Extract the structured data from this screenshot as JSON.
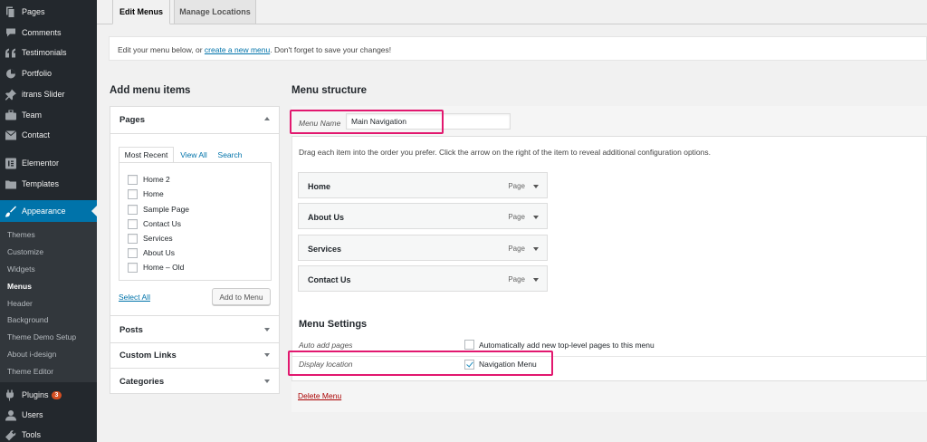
{
  "sidebar": {
    "items": [
      {
        "label": "Pages",
        "icon": "pages-icon"
      },
      {
        "label": "Comments",
        "icon": "comments-icon"
      },
      {
        "label": "Testimonials",
        "icon": "quote-icon"
      },
      {
        "label": "Portfolio",
        "icon": "portfolio-icon"
      },
      {
        "label": "itrans Slider",
        "icon": "pin-icon"
      },
      {
        "label": "Team",
        "icon": "team-icon"
      },
      {
        "label": "Contact",
        "icon": "mail-icon"
      },
      {
        "label": "Elementor",
        "icon": "elementor-icon"
      },
      {
        "label": "Templates",
        "icon": "folder-icon"
      },
      {
        "label": "Appearance",
        "icon": "brush-icon"
      },
      {
        "label": "Plugins",
        "icon": "plug-icon",
        "badge": "3"
      },
      {
        "label": "Users",
        "icon": "user-icon"
      },
      {
        "label": "Tools",
        "icon": "wrench-icon"
      }
    ],
    "submenu": [
      "Themes",
      "Customize",
      "Widgets",
      "Menus",
      "Header",
      "Background",
      "Theme Demo Setup",
      "About i-design",
      "Theme Editor"
    ],
    "current_submenu": "Menus"
  },
  "tabs": {
    "edit_menus": "Edit Menus",
    "manage_locations": "Manage Locations"
  },
  "notice": {
    "before": "Edit your menu below, or ",
    "link": "create a new menu",
    "after": ". Don't forget to save your changes!"
  },
  "add_items": {
    "title": "Add menu items",
    "pages": {
      "header": "Pages",
      "tabs": [
        "Most Recent",
        "View All",
        "Search"
      ],
      "list": [
        "Home 2",
        "Home",
        "Sample Page",
        "Contact Us",
        "Services",
        "About Us",
        "Home – Old"
      ],
      "select_all": "Select All",
      "add_button": "Add to Menu"
    },
    "other_sections": [
      "Posts",
      "Custom Links",
      "Categories"
    ]
  },
  "menu_structure": {
    "title": "Menu structure",
    "menu_name_label": "Menu Name",
    "menu_name_value": "Main Navigation",
    "help": "Drag each item into the order you prefer. Click the arrow on the right of the item to reveal additional configuration options.",
    "items": [
      {
        "title": "Home",
        "type": "Page"
      },
      {
        "title": "About Us",
        "type": "Page"
      },
      {
        "title": "Services",
        "type": "Page"
      },
      {
        "title": "Contact Us",
        "type": "Page"
      }
    ],
    "settings": {
      "title": "Menu Settings",
      "auto_add_label": "Auto add pages",
      "auto_add_text": "Automatically add new top-level pages to this menu",
      "auto_add_checked": false,
      "display_location_label": "Display location",
      "location_text": "Navigation Menu",
      "location_checked": true
    },
    "delete_label": "Delete Menu"
  },
  "colors": {
    "accent": "#0073aa",
    "highlight": "#e2186f",
    "sidebar_bg": "#23282d",
    "danger": "#aa0000"
  }
}
